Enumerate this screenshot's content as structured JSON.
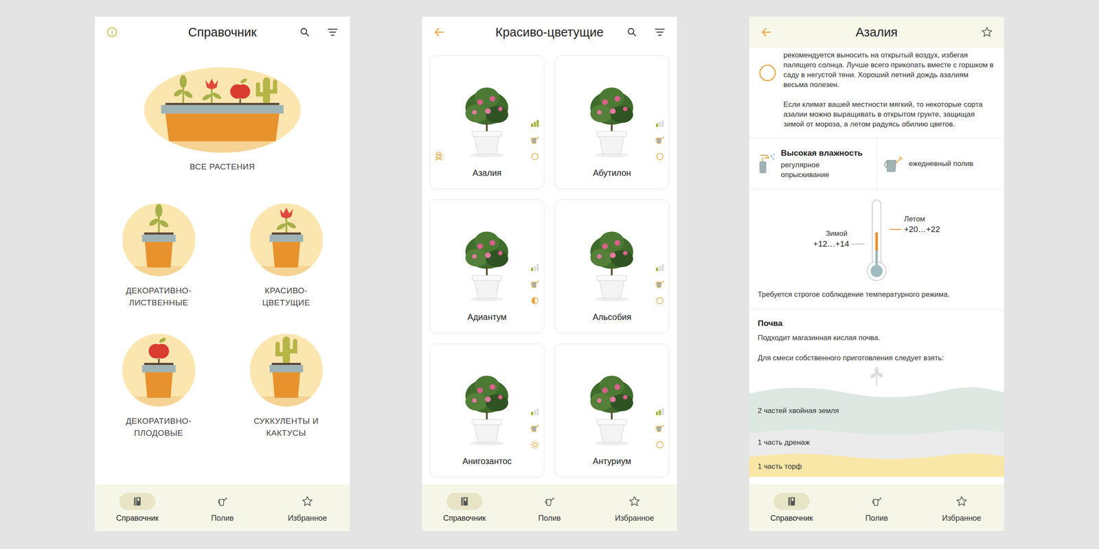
{
  "nav": [
    {
      "label": "Справочник",
      "selected": true
    },
    {
      "label": "Полив",
      "selected": false
    },
    {
      "label": "Избранное",
      "selected": false
    }
  ],
  "catalog": {
    "title": "Справочник",
    "all_plants": "ВСЕ РАСТЕНИЯ",
    "categories": [
      {
        "kind": "leaf",
        "lines": [
          "ДЕКОРАТИВНО-",
          "ЛИСТВЕННЫЕ"
        ]
      },
      {
        "kind": "flower",
        "lines": [
          "КРАСИВО-",
          "ЦВЕТУЩИЕ"
        ]
      },
      {
        "kind": "fruit",
        "lines": [
          "ДЕКОРАТИВНО-",
          "ПЛОДОВЫЕ"
        ]
      },
      {
        "kind": "cactus",
        "lines": [
          "СУККУЛЕНТЫ И",
          "КАКТУСЫ"
        ]
      }
    ]
  },
  "category": {
    "title": "Красиво-цветущие",
    "plants": [
      {
        "name": "Азалия",
        "bars": 3,
        "light": "shade",
        "toxic": true
      },
      {
        "name": "Абутилон",
        "bars": 1,
        "light": "shade",
        "toxic": false
      },
      {
        "name": "Адиантум",
        "bars": 1,
        "light": "partial",
        "toxic": false
      },
      {
        "name": "Альсобия",
        "bars": 1,
        "light": "shade",
        "toxic": false
      },
      {
        "name": "Анигозантос",
        "bars": 1,
        "light": "sun",
        "toxic": false
      },
      {
        "name": "Антуриум",
        "bars": 2,
        "light": "shade",
        "toxic": false
      }
    ]
  },
  "detail": {
    "title": "Азалия",
    "favorite": false,
    "care_text": [
      "рекомендуется выносить на открытый воздух, избегая палящего солнца. Лучше всего прикопать вместе с горшком в саду в негустой тени. Хороший летний дождь азалиям весьма полезен.",
      "Если климат вашей местности мягкий, то некоторые сорта азалии можно выращивать в открытом грунте, защищая зимой от мороза, а летом радуясь обилию цветов."
    ],
    "humidity": {
      "title": "Высокая влажность",
      "note": "регулярное опрыскивание"
    },
    "watering": {
      "note": "ежедневный полив"
    },
    "temperature": {
      "winter_label": "Зимой",
      "winter": "+12…+14",
      "summer_label": "Летом",
      "summer": "+20…+22",
      "note": "Требуется строгое соблюдение температурного режима."
    },
    "soil": {
      "title": "Почва",
      "text": "Подходит магазинная кислая почва.",
      "mix_intro": "Для смеси собственного приготовления следует взять:",
      "layers": [
        {
          "label": "2 частей хвойная земля",
          "color": "#dde8e2"
        },
        {
          "label": "1 часть дренаж",
          "color": "#ebebeb"
        },
        {
          "label": "1 часть торф",
          "color": "#f9e7a8"
        }
      ]
    }
  }
}
